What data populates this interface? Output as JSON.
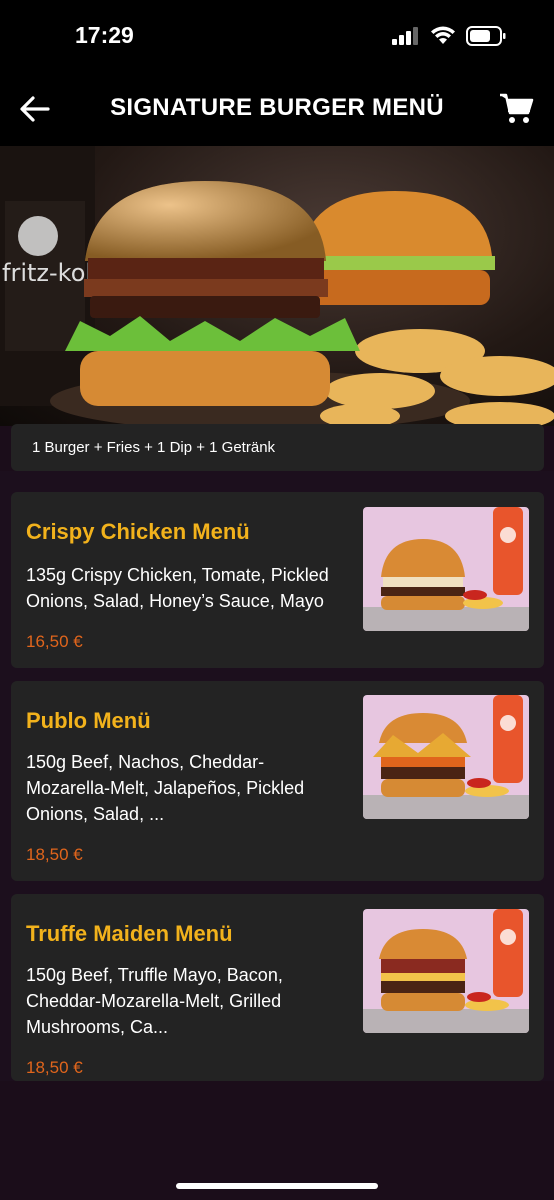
{
  "status_bar": {
    "time": "17:29"
  },
  "header": {
    "title": "SIGNATURE BURGER MENÜ",
    "back_icon": "arrow-left-icon",
    "cart_icon": "shopping-cart-icon"
  },
  "hero": {
    "description": "1 Burger + Fries + 1 Dip + 1 Getränk"
  },
  "menu_items": [
    {
      "title": "Crispy Chicken Menü",
      "description": "135g Crispy Chicken, Tomate, Pickled Onions, Salad, Honey’s Sauce, Mayo",
      "price": "16,50 €"
    },
    {
      "title": "Publo Menü",
      "description": "150g Beef, Nachos, Cheddar-Mozarella-Melt, Jalapeños, Pickled Onions, Salad, ...",
      "price": "18,50 €"
    },
    {
      "title": "Truffe Maiden Menü",
      "description": "150g Beef, Truffle Mayo, Bacon, Cheddar-Mozarella-Melt, Grilled Mushrooms, Ca...",
      "price": "18,50 €"
    }
  ],
  "colors": {
    "title_accent": "#f2b21c",
    "price": "#e0651c",
    "card_bg": "#232323",
    "page_bg": "#1b0d1a"
  }
}
